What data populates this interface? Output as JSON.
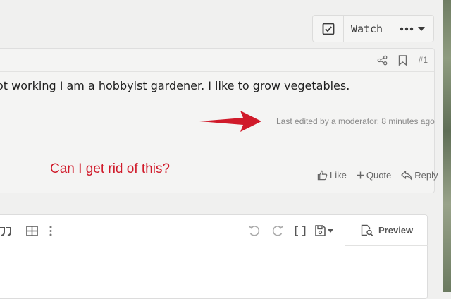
{
  "thread_actions": {
    "watch_label": "Watch"
  },
  "post": {
    "number": "#1",
    "body": "ot working I am a hobbyist gardener. I like to grow vegetables.",
    "edited_note": "Last edited by a moderator: 8 minutes ago",
    "actions": {
      "like": "Like",
      "quote": "Quote",
      "reply": "Reply"
    }
  },
  "annotation": {
    "text": "Can I get rid of this?",
    "color": "#d01a2a"
  },
  "editor": {
    "preview_label": "Preview"
  },
  "colors": {
    "accent_red": "#d01a2a",
    "panel_bg": "#f4f4f3",
    "text_muted": "#8a8a8a"
  }
}
